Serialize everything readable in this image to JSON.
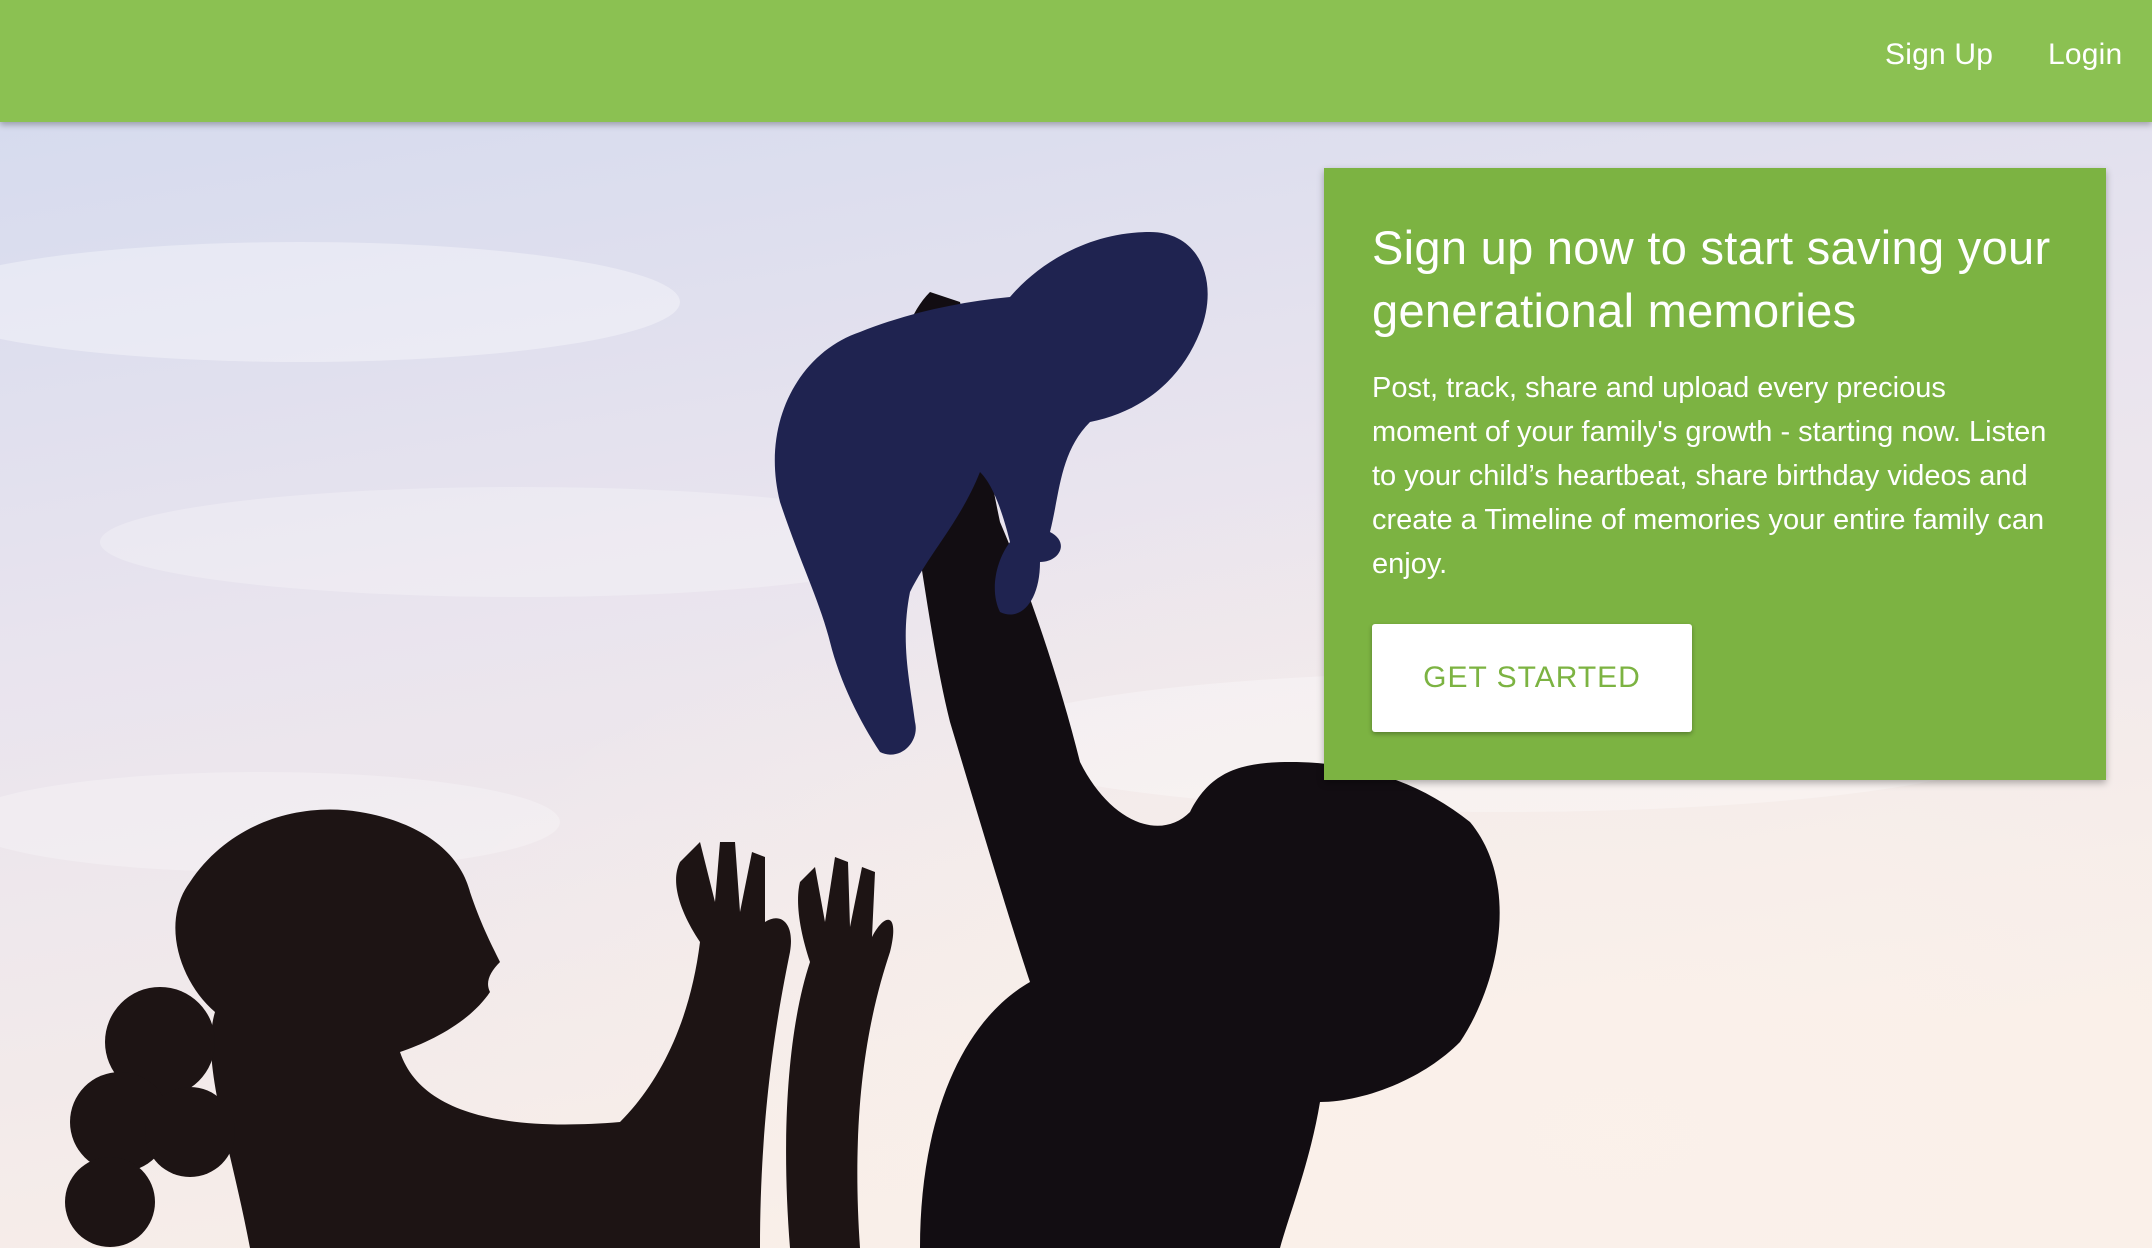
{
  "navbar": {
    "sign_up_label": "Sign Up",
    "login_label": "Login",
    "color": "#8bc152"
  },
  "hero": {
    "image": "family-silhouette-lifting-baby",
    "sky_colors": [
      "#dcdff0",
      "#f6ede9"
    ]
  },
  "cta_card": {
    "title": "Sign up now to start saving your generational memories",
    "body": "Post, track, share and upload every precious moment of your family's growth - starting now. Listen to your child’s heartbeat, share birthday videos and create a Timeline of memories your entire family can enjoy.",
    "button_label": "GET STARTED",
    "color": "#7cb342"
  }
}
